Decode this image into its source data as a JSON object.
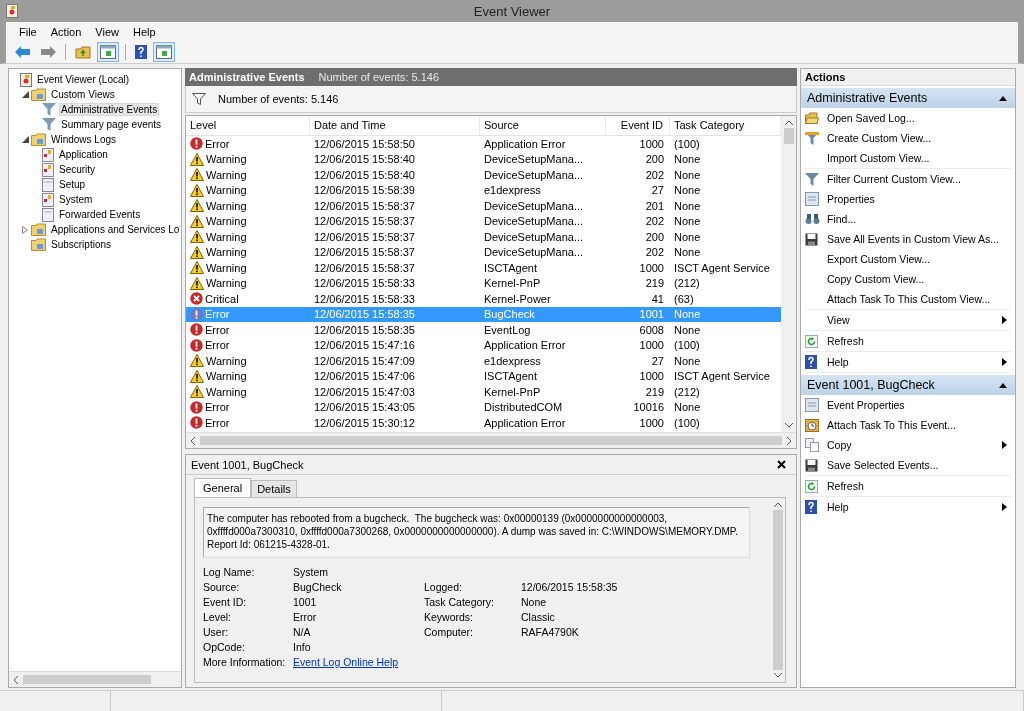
{
  "window": {
    "title": "Event Viewer"
  },
  "menu": [
    "File",
    "Action",
    "View",
    "Help"
  ],
  "toolbar": [
    {
      "kind": "back"
    },
    {
      "kind": "forward"
    },
    {
      "kind": "separator"
    },
    {
      "kind": "folder-up"
    },
    {
      "kind": "panel"
    },
    {
      "kind": "separator"
    },
    {
      "kind": "help"
    },
    {
      "kind": "panel"
    }
  ],
  "tree": [
    {
      "label": "Event Viewer (Local)",
      "kind": "computer",
      "selected": false,
      "children": [
        {
          "label": "Custom Views",
          "kind": "folder",
          "selected": false,
          "expanded": true,
          "children": [
            {
              "label": "Administrative Events",
              "kind": "filter",
              "selected": true
            },
            {
              "label": "Summary page events",
              "kind": "filter",
              "selected": false
            }
          ]
        },
        {
          "label": "Windows Logs",
          "kind": "folder",
          "selected": false,
          "expanded": true,
          "children": [
            {
              "label": "Application",
              "kind": "log",
              "selected": false
            },
            {
              "label": "Security",
              "kind": "log",
              "selected": false
            },
            {
              "label": "Setup",
              "kind": "blank-log",
              "selected": false
            },
            {
              "label": "System",
              "kind": "log",
              "selected": false
            },
            {
              "label": "Forwarded Events",
              "kind": "blank-log",
              "selected": false
            }
          ]
        },
        {
          "label": "Applications and Services Lo",
          "kind": "folder",
          "selected": false,
          "expanded": false
        },
        {
          "label": "Subscriptions",
          "kind": "folder",
          "selected": false
        }
      ]
    }
  ],
  "center": {
    "title": "Administrative Events",
    "count": "Number of events: 5.146",
    "filter_text": "Number of events: 5.146"
  },
  "table": {
    "columns": [
      "Level",
      "Date and Time",
      "Source",
      "Event ID",
      "Task Category"
    ],
    "rows": [
      {
        "kind": "error",
        "level": "Error",
        "date": "12/06/2015 15:58:50",
        "source": "Application Error",
        "id": "1000",
        "category": "(100)",
        "selected": false
      },
      {
        "kind": "warning",
        "level": "Warning",
        "date": "12/06/2015 15:58:40",
        "source": "DeviceSetupMana...",
        "id": "200",
        "category": "None",
        "selected": false
      },
      {
        "kind": "warning",
        "level": "Warning",
        "date": "12/06/2015 15:58:40",
        "source": "DeviceSetupMana...",
        "id": "202",
        "category": "None",
        "selected": false
      },
      {
        "kind": "warning",
        "level": "Warning",
        "date": "12/06/2015 15:58:39",
        "source": "e1dexpress",
        "id": "27",
        "category": "None",
        "selected": false
      },
      {
        "kind": "warning",
        "level": "Warning",
        "date": "12/06/2015 15:58:37",
        "source": "DeviceSetupMana...",
        "id": "201",
        "category": "None",
        "selected": false
      },
      {
        "kind": "warning",
        "level": "Warning",
        "date": "12/06/2015 15:58:37",
        "source": "DeviceSetupMana...",
        "id": "202",
        "category": "None",
        "selected": false
      },
      {
        "kind": "warning",
        "level": "Warning",
        "date": "12/06/2015 15:58:37",
        "source": "DeviceSetupMana...",
        "id": "200",
        "category": "None",
        "selected": false
      },
      {
        "kind": "warning",
        "level": "Warning",
        "date": "12/06/2015 15:58:37",
        "source": "DeviceSetupMana...",
        "id": "202",
        "category": "None",
        "selected": false
      },
      {
        "kind": "warning",
        "level": "Warning",
        "date": "12/06/2015 15:58:37",
        "source": "ISCTAgent",
        "id": "1000",
        "category": "ISCT Agent Service",
        "selected": false
      },
      {
        "kind": "warning",
        "level": "Warning",
        "date": "12/06/2015 15:58:33",
        "source": "Kernel-PnP",
        "id": "219",
        "category": "(212)",
        "selected": false
      },
      {
        "kind": "critical",
        "level": "Critical",
        "date": "12/06/2015 15:58:33",
        "source": "Kernel-Power",
        "id": "41",
        "category": "(63)",
        "selected": false
      },
      {
        "kind": "error",
        "level": "Error",
        "date": "12/06/2015 15:58:35",
        "source": "BugCheck",
        "id": "1001",
        "category": "None",
        "selected": true
      },
      {
        "kind": "error",
        "level": "Error",
        "date": "12/06/2015 15:58:35",
        "source": "EventLog",
        "id": "6008",
        "category": "None",
        "selected": false
      },
      {
        "kind": "error",
        "level": "Error",
        "date": "12/06/2015 15:47:16",
        "source": "Application Error",
        "id": "1000",
        "category": "(100)",
        "selected": false
      },
      {
        "kind": "warning",
        "level": "Warning",
        "date": "12/06/2015 15:47:09",
        "source": "e1dexpress",
        "id": "27",
        "category": "None",
        "selected": false
      },
      {
        "kind": "warning",
        "level": "Warning",
        "date": "12/06/2015 15:47:06",
        "source": "ISCTAgent",
        "id": "1000",
        "category": "ISCT Agent Service",
        "selected": false
      },
      {
        "kind": "warning",
        "level": "Warning",
        "date": "12/06/2015 15:47:03",
        "source": "Kernel-PnP",
        "id": "219",
        "category": "(212)",
        "selected": false
      },
      {
        "kind": "error",
        "level": "Error",
        "date": "12/06/2015 15:43:05",
        "source": "DistributedCOM",
        "id": "10016",
        "category": "None",
        "selected": false
      },
      {
        "kind": "error",
        "level": "Error",
        "date": "12/06/2015 15:30:12",
        "source": "Application Error",
        "id": "1000",
        "category": "(100)",
        "selected": false
      }
    ]
  },
  "details": {
    "title": "Event 1001, BugCheck",
    "tabs": [
      {
        "label": "General",
        "selected": true
      },
      {
        "label": "Details",
        "selected": false
      }
    ],
    "message": "The computer has rebooted from a bugcheck.  The bugcheck was: 0x00000139 (0x0000000000000003, 0xffffd000a7300310, 0xffffd000a7300268, 0x0000000000000000). A dump was saved in: C:\\WINDOWS\\MEMORY.DMP. Report Id: 061215-4328-01.",
    "fields": [
      {
        "label": "Log Name:",
        "value": "System",
        "kind": "text"
      },
      {
        "label": "Source:",
        "value": "BugCheck",
        "kind": "text",
        "right": {
          "label": "Logged:",
          "value": "12/06/2015 15:58:35"
        }
      },
      {
        "label": "Event ID:",
        "value": "1001",
        "kind": "text",
        "right": {
          "label": "Task Category:",
          "value": "None"
        }
      },
      {
        "label": "Level:",
        "value": "Error",
        "kind": "text",
        "right": {
          "label": "Keywords:",
          "value": "Classic"
        }
      },
      {
        "label": "User:",
        "value": "N/A",
        "kind": "text",
        "right": {
          "label": "Computer:",
          "value": "RAFA4790K"
        }
      },
      {
        "label": "OpCode:",
        "value": "Info",
        "kind": "text"
      },
      {
        "label": "More Information:",
        "value": "Event Log Online Help",
        "kind": "link"
      }
    ]
  },
  "actions": {
    "title": "Actions",
    "sections": [
      {
        "title": "Administrative Events",
        "groups": [
          [
            {
              "label": "Open Saved Log...",
              "kind": "folder",
              "submenu": false
            },
            {
              "label": "Create Custom View...",
              "kind": "filter-new",
              "submenu": false
            },
            {
              "label": "Import Custom View...",
              "kind": "plain",
              "submenu": false
            }
          ],
          [
            {
              "label": "Filter Current Custom View...",
              "kind": "filter",
              "submenu": false
            },
            {
              "label": "Properties",
              "kind": "properties",
              "submenu": false
            },
            {
              "label": "Find...",
              "kind": "find",
              "submenu": false
            },
            {
              "label": "Save All Events in Custom View As...",
              "kind": "save",
              "submenu": false
            },
            {
              "label": "Export Custom View...",
              "kind": "plain",
              "submenu": false
            },
            {
              "label": "Copy Custom View...",
              "kind": "plain",
              "submenu": false
            },
            {
              "label": "Attach Task To This Custom View...",
              "kind": "plain",
              "submenu": false
            }
          ],
          [
            {
              "label": "View",
              "kind": "plain",
              "submenu": true
            }
          ],
          [
            {
              "label": "Refresh",
              "kind": "refresh",
              "submenu": false
            }
          ],
          [
            {
              "label": "Help",
              "kind": "help",
              "submenu": true
            }
          ]
        ]
      },
      {
        "title": "Event 1001, BugCheck",
        "groups": [
          [
            {
              "label": "Event Properties",
              "kind": "properties",
              "submenu": false
            },
            {
              "label": "Attach Task To This Event...",
              "kind": "task",
              "submenu": false
            },
            {
              "label": "Copy",
              "kind": "copy",
              "submenu": true
            },
            {
              "label": "Save Selected Events...",
              "kind": "save",
              "submenu": false
            }
          ],
          [
            {
              "label": "Refresh",
              "kind": "refresh",
              "submenu": false
            }
          ],
          [
            {
              "label": "Help",
              "kind": "help",
              "submenu": true
            }
          ]
        ]
      }
    ]
  }
}
